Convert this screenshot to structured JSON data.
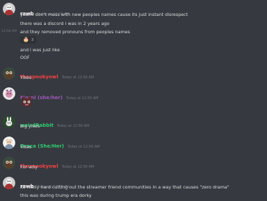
{
  "colors": {
    "background": "#36393f",
    "text": "#dcddde",
    "timestamp": "#72767d",
    "user_white": "#ffffff",
    "user_red": "#ed4245",
    "user_purple": "#9b59b6",
    "user_green": "#2ecc71"
  },
  "messages": [
    {
      "user": "rawb",
      "time": "Today at 12:56 AM",
      "avatar": "rawb-avatar-icon",
      "lines": [
        "yeah i don't mess with new peoples names cause its just instant disrespect",
        "there was a discord i was in 2 years ago",
        "and they removed pronouns from peoples names",
        "and i was just like",
        "OOF"
      ],
      "hover_time": "12:56 AM",
      "reaction": {
        "emoji": "cake-emoji-icon",
        "count": "3"
      }
    },
    {
      "user": "thespookyowl",
      "time": "Today at 12:56 AM",
      "avatar": "owl-avatar-icon",
      "lines": [
        "Yikes"
      ]
    },
    {
      "user": "Morni (she/her)",
      "time": "Today at 12:56 AM",
      "avatar": "morni-avatar-icon",
      "sticker": "bug-sticker-icon"
    },
    {
      "user": "weirdRabbit",
      "time": "Today at 12:56 AM",
      "avatar": "rabbit-avatar-icon",
      "lines": [
        "big yikes"
      ]
    },
    {
      "user": "Draca (She/Her)",
      "time": "Today at 12:56 AM",
      "avatar": "draca-avatar-icon",
      "lines": [
        "Yikes"
      ]
    },
    {
      "user": "thespookyowl",
      "time": "Today at 12:56 AM",
      "avatar": "owl-avatar-icon",
      "lines": [
        "For why"
      ]
    },
    {
      "user": "rawb",
      "time": "Today at 12:58 PM",
      "avatar": "rawb-avatar-icon",
      "lines": [
        "its really hard cutting out the streamer friend communities in a way that causes \"zero drama\"",
        "this was during trump era dorky"
      ]
    }
  ]
}
